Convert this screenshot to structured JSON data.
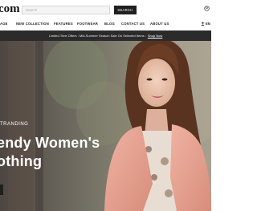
{
  "header": {
    "logo_text": "com",
    "search_placeholder": "Search",
    "search_button": "SEARCH",
    "icons": [
      "account-icon"
    ]
  },
  "nav": {
    "items": [
      "AGE",
      "NEW COLLECTION",
      "FEATURES",
      "FOOTWEAR",
      "BLOG",
      "CONTACT US",
      "ABOUT US"
    ],
    "right_label": "EN",
    "right_icon": "user-icon"
  },
  "announcement": {
    "text": "Limited-Time Offers : Mid-Summer Season Sale On Selected Items :",
    "link": "Shop Now"
  },
  "hero": {
    "tag": "TRANDING",
    "title_line1": "endy Women's",
    "title_line2": "othing",
    "colors": {
      "coat": "#e8a594",
      "hair": "#5a3320",
      "background": "#6f6a5e"
    }
  }
}
